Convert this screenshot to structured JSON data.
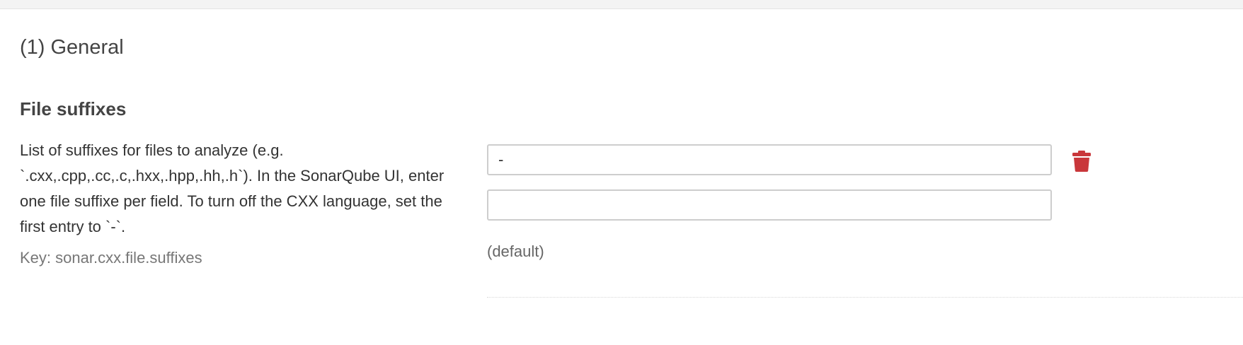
{
  "section": {
    "title": "(1) General"
  },
  "setting": {
    "name": "File suffixes",
    "description": "List of suffixes for files to analyze (e.g. `.cxx,.cpp,.cc,.c,.hxx,.hpp,.hh,.h`). In the SonarQube UI, enter one file suffixe per field. To turn off the CXX language, set the first entry to `-`.",
    "key": "Key: sonar.cxx.file.suffixes",
    "values": [
      "-",
      ""
    ],
    "default_label": "(default)",
    "delete_icon": "trash-icon",
    "delete_color": "#c9373b"
  }
}
